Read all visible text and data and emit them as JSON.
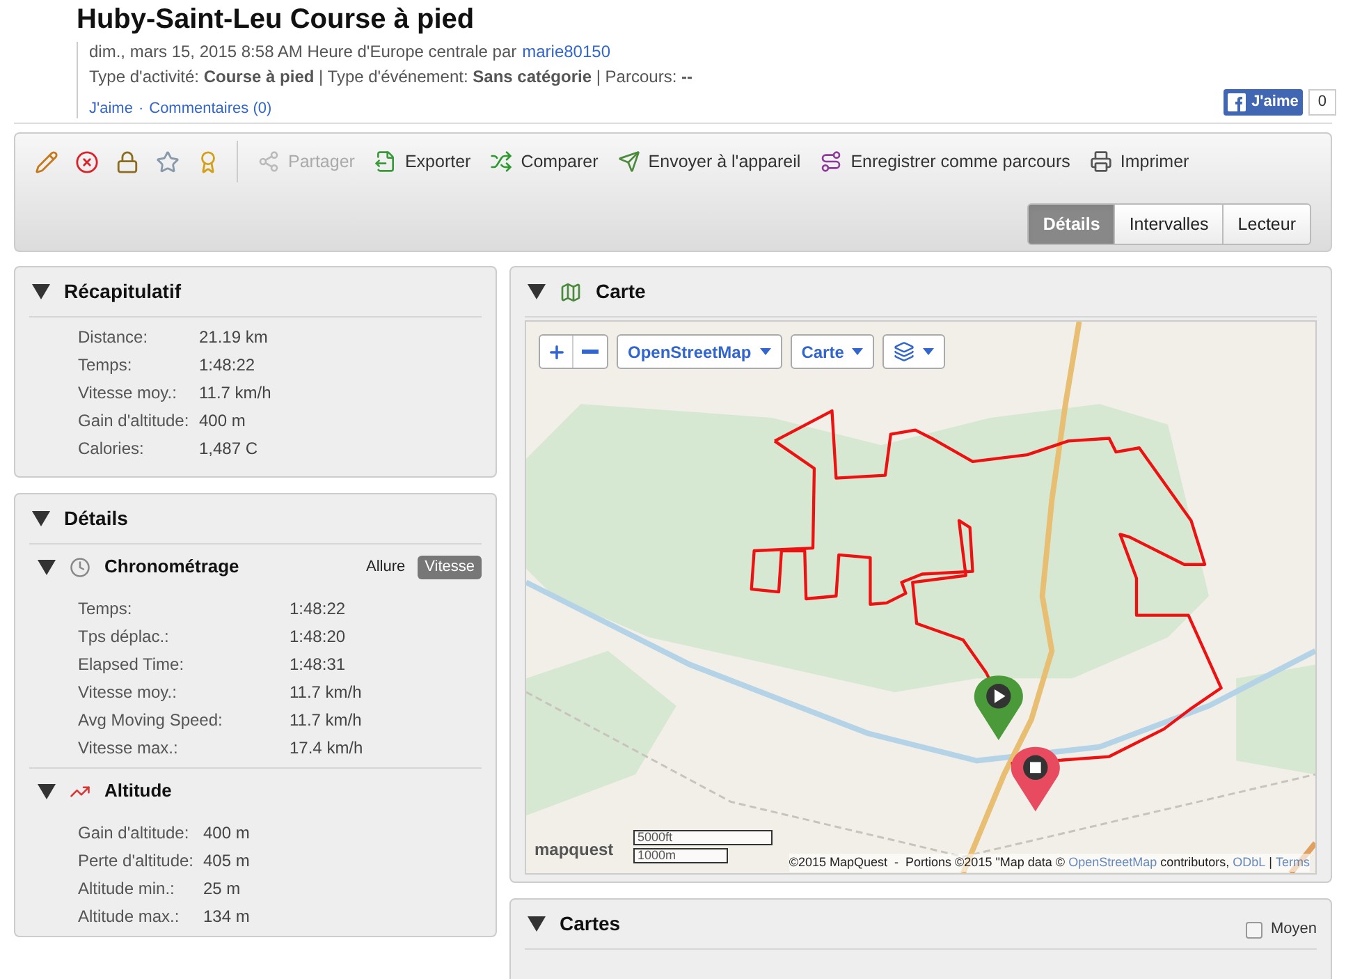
{
  "activity": {
    "title": "Huby-Saint-Leu Course à pied",
    "date_line": "dim., mars 15, 2015 8:58 AM Heure d'Europe centrale par",
    "user": "marie80150",
    "type_line": "Type d'activité: **Course à pied** | Type d'événement: **Sans catégorie** | Parcours: **--**",
    "like_link": "J'aime",
    "separator": "·",
    "comments_link": "Commentaires (0)",
    "fb_like": {
      "label": "J'aime",
      "count": "0"
    }
  },
  "toolbar": {
    "icon_buttons": [
      {
        "kind": "edit"
      },
      {
        "kind": "delete"
      },
      {
        "kind": "privacy"
      },
      {
        "kind": "favorite"
      },
      {
        "kind": "badge"
      }
    ],
    "actions": [
      {
        "kind": "share",
        "label": "Partager",
        "disabled": true
      },
      {
        "kind": "export",
        "label": "Exporter",
        "disabled": false
      },
      {
        "kind": "compare",
        "label": "Comparer",
        "disabled": false
      },
      {
        "kind": "device",
        "label": "Envoyer à l'appareil",
        "disabled": false
      },
      {
        "kind": "course",
        "label": "Enregistrer comme parcours",
        "disabled": false
      },
      {
        "kind": "print",
        "label": "Imprimer",
        "disabled": false
      }
    ],
    "view_tabs": [
      {
        "label": "Détails",
        "selected": true
      },
      {
        "label": "Intervalles",
        "selected": false
      },
      {
        "label": "Lecteur",
        "selected": false
      }
    ]
  },
  "summary": {
    "title": "Récapitulatif",
    "expanded": true,
    "rows": [
      {
        "label": "Distance:",
        "value": "21.19 km"
      },
      {
        "label": "Temps:",
        "value": "1:48:22"
      },
      {
        "label": "Vitesse moy.:",
        "value": "11.7 km/h"
      },
      {
        "label": "Gain d'altitude:",
        "value": "400 m"
      },
      {
        "label": "Calories:",
        "value": "1,487 C"
      }
    ]
  },
  "details": {
    "title": "Détails",
    "expanded": true,
    "sections": [
      {
        "kind": "timing",
        "title": "Chronométrage",
        "expanded": true,
        "toggle": [
          {
            "label": "Allure",
            "selected": false
          },
          {
            "label": "Vitesse",
            "selected": true
          }
        ],
        "rows": [
          {
            "label": "Temps:",
            "value": "1:48:22"
          },
          {
            "label": "Tps déplac.:",
            "value": "1:48:20"
          },
          {
            "label": "Elapsed Time:",
            "value": "1:48:31"
          },
          {
            "label": "Vitesse moy.:",
            "value": "11.7 km/h"
          },
          {
            "label": "Avg Moving Speed:",
            "value": "11.7 km/h"
          },
          {
            "label": "Vitesse max.:",
            "value": "17.4 km/h"
          }
        ]
      },
      {
        "kind": "elevation",
        "title": "Altitude",
        "expanded": true,
        "rows": [
          {
            "label": "Gain d'altitude:",
            "value": "400 m"
          },
          {
            "label": "Perte d'altitude:",
            "value": "405 m"
          },
          {
            "label": "Altitude min.:",
            "value": "25 m"
          },
          {
            "label": "Altitude max.:",
            "value": "134 m"
          }
        ]
      }
    ]
  },
  "map_panel": {
    "title": "Carte",
    "expanded": true,
    "provider": "OpenStreetMap",
    "view": "Carte",
    "logo": "mapquest",
    "scale": [
      "5000ft",
      "1000m"
    ],
    "attribution": "©2015 MapQuest  -  Portions ©2015 \"Map data © ",
    "attribution_link": "OpenStreetMap",
    "attribution_end": " contributors, ",
    "license_link": "ODbL",
    "pipe": " | ",
    "terms_link": "Terms"
  },
  "charts_panel": {
    "title": "Cartes",
    "expanded": true,
    "average": {
      "label": "Moyen",
      "checked": false
    }
  }
}
